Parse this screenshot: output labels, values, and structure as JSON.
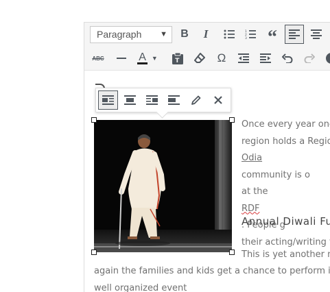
{
  "toolbar": {
    "format_value": "Paragraph",
    "row1": [
      {
        "name": "bold-icon",
        "glyph": "B"
      },
      {
        "name": "italic-icon",
        "glyph": "I"
      },
      {
        "name": "bullet-list-icon"
      },
      {
        "name": "numbered-list-icon"
      },
      {
        "name": "blockquote-icon",
        "glyph": "“"
      },
      {
        "name": "align-left-icon",
        "active": true
      },
      {
        "name": "align-center-icon"
      }
    ],
    "row2": [
      {
        "name": "strikethrough-icon",
        "glyph": "ABC"
      },
      {
        "name": "horizontal-line-icon"
      },
      {
        "name": "text-color-icon",
        "glyph": "A"
      },
      {
        "name": "paste-as-text-icon"
      },
      {
        "name": "clear-formatting-icon"
      },
      {
        "name": "special-character-icon",
        "glyph": "Ω"
      },
      {
        "name": "outdent-icon"
      },
      {
        "name": "indent-icon"
      },
      {
        "name": "undo-icon"
      },
      {
        "name": "redo-icon",
        "disabled": true
      }
    ]
  },
  "image_toolbar": {
    "buttons": [
      "align-left-icon",
      "align-center-icon",
      "align-right-icon",
      "align-none-icon",
      "edit-pencil-icon",
      "remove-x-icon"
    ],
    "active": "align-left-icon"
  },
  "content": {
    "para1_lines": [
      "Once every year one",
      "region holds a Region",
      "Odia",
      " community is o",
      "at the ",
      "RDF",
      ".  People g",
      "their acting/writing ta"
    ],
    "heading": "Annual Diwali Fun",
    "para2_line1": "This is yet another m",
    "para2_line2": "again the families and kids get a chance to perform in f",
    "para2_line3": "well organized event"
  },
  "colors": {
    "accent_border": "#50575e",
    "text": "#707070",
    "toolbar_bg": "#f5f5f5"
  }
}
